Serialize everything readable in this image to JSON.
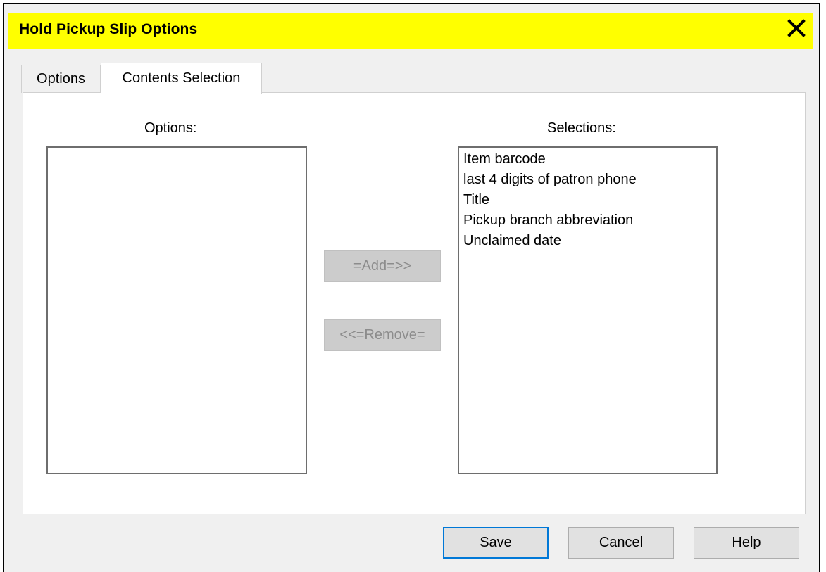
{
  "window": {
    "title": "Hold Pickup Slip Options",
    "title_bar_color": "#ffff00",
    "close_icon": "close-icon"
  },
  "tabs": [
    {
      "label": "Options",
      "active": false
    },
    {
      "label": "Contents Selection",
      "active": true
    }
  ],
  "options_list": {
    "label": "Options:",
    "items": []
  },
  "selections_list": {
    "label": "Selections:",
    "items": [
      "Item barcode",
      "last 4 digits of patron phone",
      "Title",
      "Pickup branch abbreviation",
      "Unclaimed date"
    ]
  },
  "transfer_buttons": {
    "add_label": "=Add=>>",
    "remove_label": "<<=Remove=",
    "disabled": true
  },
  "footer": {
    "save_label": "Save",
    "cancel_label": "Cancel",
    "help_label": "Help"
  }
}
